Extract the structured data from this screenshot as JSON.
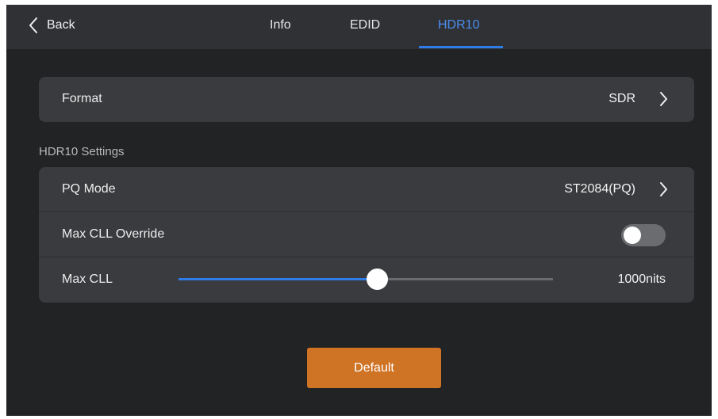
{
  "header": {
    "back_label": "Back",
    "tabs": [
      {
        "label": "Info",
        "active": false
      },
      {
        "label": "EDID",
        "active": false
      },
      {
        "label": "HDR10",
        "active": true
      }
    ],
    "accent_color": "#2f7ce6"
  },
  "format": {
    "label": "Format",
    "value": "SDR"
  },
  "hdr10_settings": {
    "title": "HDR10 Settings",
    "pq_mode": {
      "label": "PQ Mode",
      "value": "ST2084(PQ)"
    },
    "max_cll_override": {
      "label": "Max CLL Override",
      "enabled": false
    },
    "max_cll": {
      "label": "Max CLL",
      "value_text": "1000nits",
      "slider_fraction": 0.53
    }
  },
  "default_button": {
    "label": "Default",
    "color": "#cf7325"
  },
  "icons": {
    "back": "chevron-left-icon",
    "disclosure": "chevron-right-icon"
  }
}
